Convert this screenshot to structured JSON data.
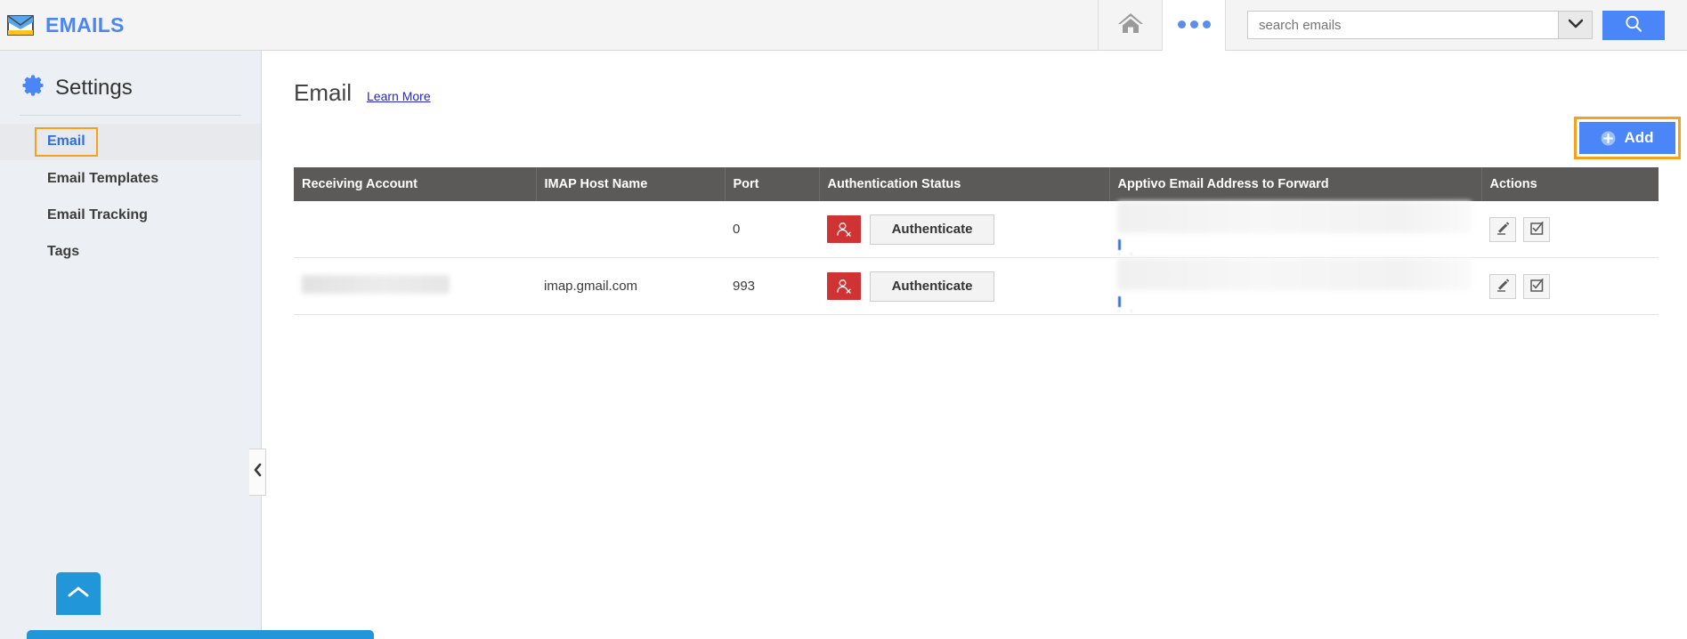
{
  "header": {
    "app_title": "EMAILS",
    "brand_icon": "envelope-icon",
    "home_icon": "home-icon",
    "more_icon": "more-dots-icon",
    "search": {
      "placeholder": "search emails",
      "value": "",
      "dropdown_icon": "chevron-down-icon",
      "submit_icon": "search-icon"
    },
    "accent_color": "#4a86f7"
  },
  "sidebar": {
    "title": "Settings",
    "gear_icon": "gear-icon",
    "items": [
      {
        "label": "Email",
        "active": true
      },
      {
        "label": "Email Templates",
        "active": false
      },
      {
        "label": "Email Tracking",
        "active": false
      },
      {
        "label": "Tags",
        "active": false
      }
    ],
    "collapse_icon": "chevron-left-icon",
    "scroll_top_icon": "chevron-up-icon",
    "highlight_color": "#f5a11d"
  },
  "main": {
    "page_title": "Email",
    "learn_more_label": "Learn More",
    "add_button": {
      "label": "Add",
      "icon": "plus-circle-icon",
      "highlighted": true
    },
    "table": {
      "columns": [
        "Receiving Account",
        "IMAP Host Name",
        "Port",
        "Authentication Status",
        "Apptivo Email Address to Forward",
        "Actions"
      ],
      "rows": [
        {
          "receiving_account": "",
          "receiving_account_redacted": false,
          "imap_host_name": "",
          "port": "0",
          "auth_status_icon": "user-denied-icon",
          "auth_status_color": "#cf3333",
          "authenticate_label": "Authenticate",
          "forward_address": "",
          "forward_address_redacted": true,
          "actions": [
            "edit-icon",
            "checkbox-icon"
          ]
        },
        {
          "receiving_account": "",
          "receiving_account_redacted": true,
          "imap_host_name": "imap.gmail.com",
          "port": "993",
          "auth_status_icon": "user-denied-icon",
          "auth_status_color": "#cf3333",
          "authenticate_label": "Authenticate",
          "forward_address": "",
          "forward_address_redacted": true,
          "actions": [
            "edit-icon",
            "checkbox-icon"
          ]
        }
      ]
    }
  }
}
